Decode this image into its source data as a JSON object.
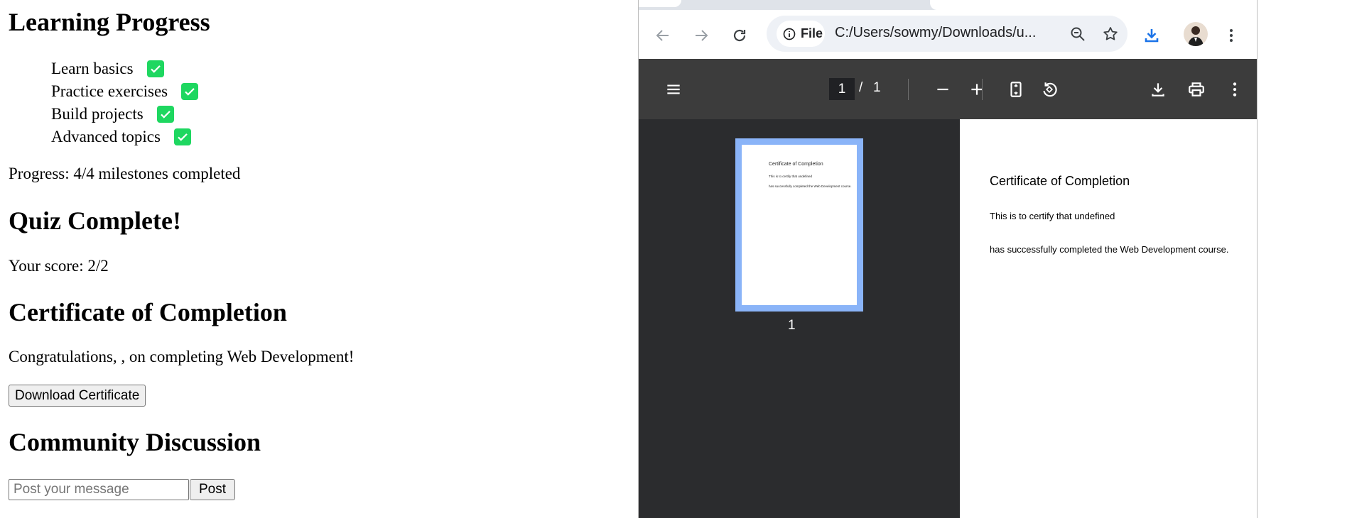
{
  "learning": {
    "heading": "Learning Progress",
    "milestones": [
      {
        "label": "Learn basics",
        "done": true
      },
      {
        "label": "Practice exercises",
        "done": true
      },
      {
        "label": "Build projects",
        "done": true
      },
      {
        "label": "Advanced topics",
        "done": true
      }
    ],
    "progress_text": "Progress: 4/4 milestones completed"
  },
  "quiz": {
    "heading": "Quiz Complete!",
    "score_text": "Your score: 2/2"
  },
  "certificate": {
    "heading": "Certificate of Completion",
    "message": "Congratulations, , on completing Web Development!",
    "download_label": "Download Certificate"
  },
  "community": {
    "heading": "Community Discussion",
    "message_placeholder": "Post your message",
    "post_label": "Post"
  },
  "browser": {
    "chip_label": "File",
    "url": "C:/Users/sowmy/Downloads/u...",
    "accent_color": "#1a73e8"
  },
  "pdf_viewer": {
    "current_page": "1",
    "separator": "/",
    "total_pages": "1",
    "thumbnail_label": "1",
    "thumbnail_lines": [
      "Certificate of Completion",
      "This is to certify that undefined",
      "has successfully completed the Web Development course."
    ],
    "document": {
      "title": "Certificate of Completion",
      "line1": "This is to certify that undefined",
      "line2": "has successfully completed the Web Development course."
    }
  }
}
